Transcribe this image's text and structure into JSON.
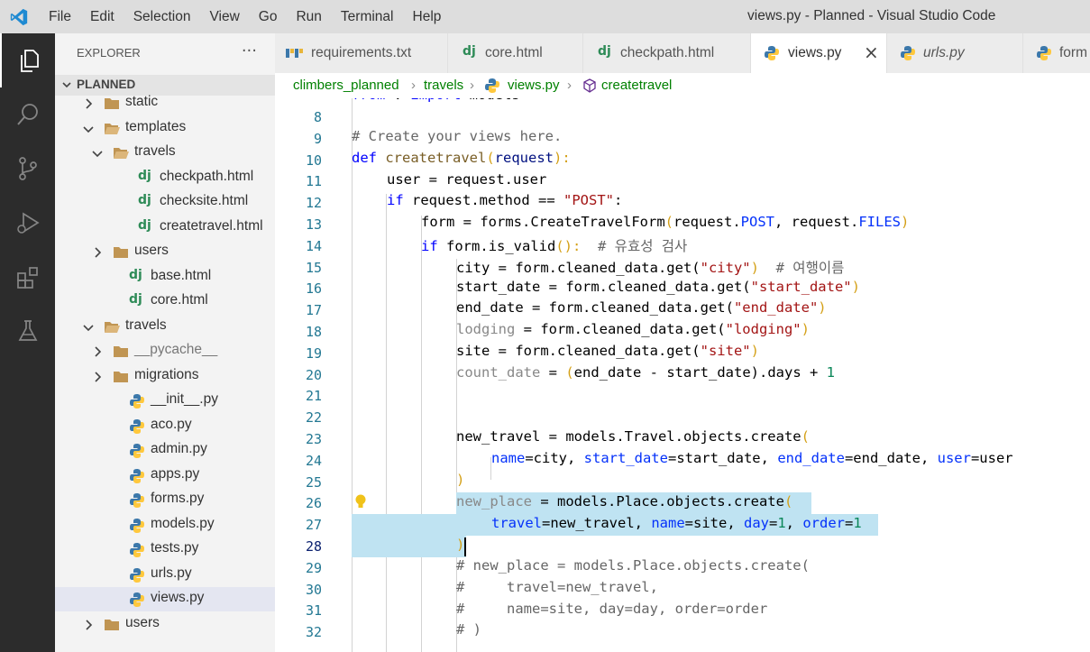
{
  "titlebar": {
    "menu": [
      "File",
      "Edit",
      "Selection",
      "View",
      "Go",
      "Run",
      "Terminal",
      "Help"
    ],
    "window_title": "views.py - Planned - Visual Studio Code"
  },
  "activity_bar": {
    "items": [
      "explorer-icon",
      "search-icon",
      "source-control-icon",
      "run-debug-icon",
      "extensions-icon",
      "testing-icon"
    ]
  },
  "sidebar": {
    "header": "EXPLORER",
    "more": "···",
    "section": "PLANNED",
    "tree": [
      {
        "name": "static",
        "icon": "folder"
      },
      {
        "name": "templates",
        "icon": "folder-open"
      },
      {
        "name": "travels",
        "icon": "folder-open"
      },
      {
        "name": "checkpath.html",
        "icon": "django"
      },
      {
        "name": "checksite.html",
        "icon": "django"
      },
      {
        "name": "createtravel.html",
        "icon": "django"
      },
      {
        "name": "users",
        "icon": "folder"
      },
      {
        "name": "base.html",
        "icon": "django"
      },
      {
        "name": "core.html",
        "icon": "django"
      },
      {
        "name": "travels",
        "icon": "folder-open"
      },
      {
        "name": "__pycache__",
        "icon": "folder"
      },
      {
        "name": "migrations",
        "icon": "folder"
      },
      {
        "name": "__init__.py",
        "icon": "python"
      },
      {
        "name": "aco.py",
        "icon": "python"
      },
      {
        "name": "admin.py",
        "icon": "python"
      },
      {
        "name": "apps.py",
        "icon": "python"
      },
      {
        "name": "forms.py",
        "icon": "python"
      },
      {
        "name": "models.py",
        "icon": "python"
      },
      {
        "name": "tests.py",
        "icon": "python"
      },
      {
        "name": "urls.py",
        "icon": "python"
      },
      {
        "name": "views.py",
        "icon": "python"
      },
      {
        "name": "users",
        "icon": "folder"
      }
    ]
  },
  "tabs": [
    {
      "label": "requirements.txt",
      "icon": "pip"
    },
    {
      "label": "core.html",
      "icon": "django"
    },
    {
      "label": "checkpath.html",
      "icon": "django"
    },
    {
      "label": "views.py",
      "icon": "python",
      "close": "×"
    },
    {
      "label": "urls.py",
      "icon": "python"
    },
    {
      "label": "form",
      "icon": "python"
    }
  ],
  "breadcrumb": [
    "climbers_planned",
    "travels",
    "views.py",
    "createtravel"
  ],
  "editor": {
    "line_numbers": [
      "8",
      "9",
      "10",
      "11",
      "12",
      "13",
      "14",
      "15",
      "16",
      "17",
      "18",
      "19",
      "20",
      "21",
      "22",
      "23",
      "24",
      "25",
      "26",
      "27",
      "28",
      "29",
      "30",
      "31",
      "32"
    ],
    "code": {
      "l7_a": "from",
      "l7_b": " . ",
      "l7_c": "import",
      "l7_d": " models",
      "l9": "# Create your views here.",
      "l10_a": "def",
      "l10_b": "createtravel",
      "l10_c": "(",
      "l10_d": "request",
      "l10_e": "):",
      "l11_a": "user",
      "l11_b": " = ",
      "l11_c": "request",
      "l11_d": ".user",
      "l12_a": "if",
      "l12_b": "request",
      "l12_c": ".method == ",
      "l12_d": "\"POST\"",
      "l12_e": ":",
      "l13_a": "form",
      "l13_b": " = ",
      "l13_c": "forms",
      "l13_d": ".",
      "l13_e": "CreateTravelForm",
      "l13_f": "(",
      "l13_g": "request",
      "l13_h": ".",
      "l13_i": "POST",
      "l13_j": ", ",
      "l13_k": "request",
      "l13_l": ".",
      "l13_m": "FILES",
      "l13_n": ")",
      "l14_a": "if",
      "l14_b": "form",
      "l14_c": ".",
      "l14_d": "is_valid",
      "l14_e": "():",
      "l14_f": "# 유효성 검사",
      "l15_a": "city",
      "l15_b": " = form.cleaned_data.get(",
      "l15_c": "\"city\"",
      "l15_d": ")",
      "l15_e": "# 여행이름",
      "l16_a": "start_date",
      "l16_b": " = form.cleaned_data.get(",
      "l16_c": "\"start_date\"",
      "l16_d": ")",
      "l17_a": "end_date",
      "l17_b": " = form.cleaned_data.get(",
      "l17_c": "\"end_date\"",
      "l17_d": ")",
      "l18_a": "lodging",
      "l18_b": " = form.cleaned_data.get(",
      "l18_c": "\"lodging\"",
      "l18_d": ")",
      "l19_a": "site",
      "l19_b": " = form.cleaned_data.get(",
      "l19_c": "\"site\"",
      "l19_d": ")",
      "l20_a": "count_date",
      "l20_b": " = ",
      "l20_c": "(",
      "l20_d": "end_date",
      "l20_e": " - ",
      "l20_f": "start_date",
      "l20_g": ").days + ",
      "l20_h": "1",
      "l23_a": "new_travel",
      "l23_b": " = models.Travel.objects.create",
      "l23_c": "(",
      "l24_a": "name",
      "l24_b": "=city, ",
      "l24_c": "start_date",
      "l24_d": "=start_date, ",
      "l24_e": "end_date",
      "l24_f": "=end_date, ",
      "l24_g": "user",
      "l24_h": "=user",
      "l25": ")",
      "l26_a": "new_place",
      "l26_b": " = models.Place.objects.create",
      "l26_c": "(",
      "l27_a": "travel",
      "l27_b": "=new_travel, ",
      "l27_c": "name",
      "l27_d": "=site, ",
      "l27_e": "day",
      "l27_f": "=",
      "l27_g": "1",
      "l27_h": ", ",
      "l27_i": "order",
      "l27_j": "=",
      "l27_k": "1",
      "l28": ")",
      "l29": "# new_place = models.Place.objects.create(",
      "l30": "#     travel=new_travel,",
      "l31": "#     name=site, day=day, order=order",
      "l32": "# )"
    }
  },
  "colors": {
    "accent": "#007acc",
    "activity_bar": "#2c2c2c",
    "selection": "#bfe3f2"
  }
}
